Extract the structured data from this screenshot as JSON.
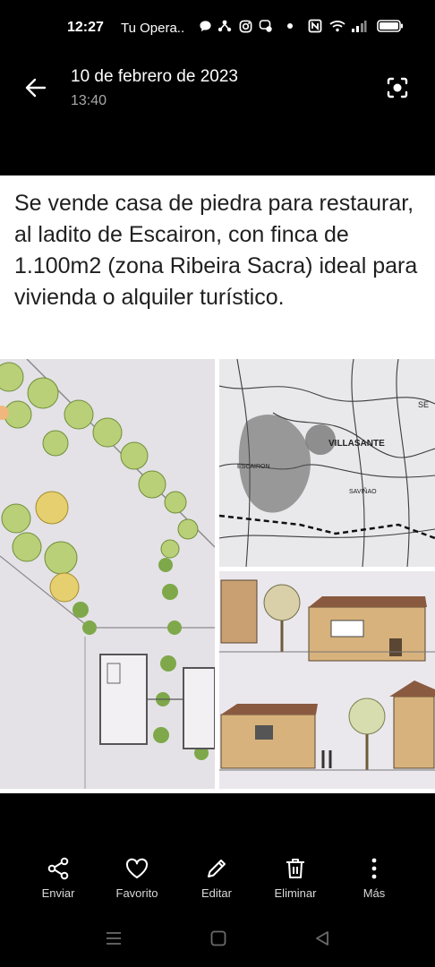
{
  "status_bar": {
    "time": "12:27",
    "carrier": "Tu Opera.."
  },
  "header": {
    "date": "10 de febrero de 2023",
    "time": "13:40"
  },
  "post": {
    "text": "Se vende casa de piedra para restaurar, al ladito de Escairon, con finca de 1.100m2 (zona Ribeira Sacra) ideal para vivienda o alquiler turístico."
  },
  "map_labels": {
    "village": "VILLASANTE",
    "town": "ESCAIRON",
    "town2": "SAVIÑAO",
    "corner": "SE"
  },
  "actions": [
    {
      "label": "Enviar",
      "icon": "share-icon"
    },
    {
      "label": "Favorito",
      "icon": "heart-icon"
    },
    {
      "label": "Editar",
      "icon": "pencil-icon"
    },
    {
      "label": "Eliminar",
      "icon": "trash-icon"
    },
    {
      "label": "Más",
      "icon": "more-vertical-icon"
    }
  ]
}
